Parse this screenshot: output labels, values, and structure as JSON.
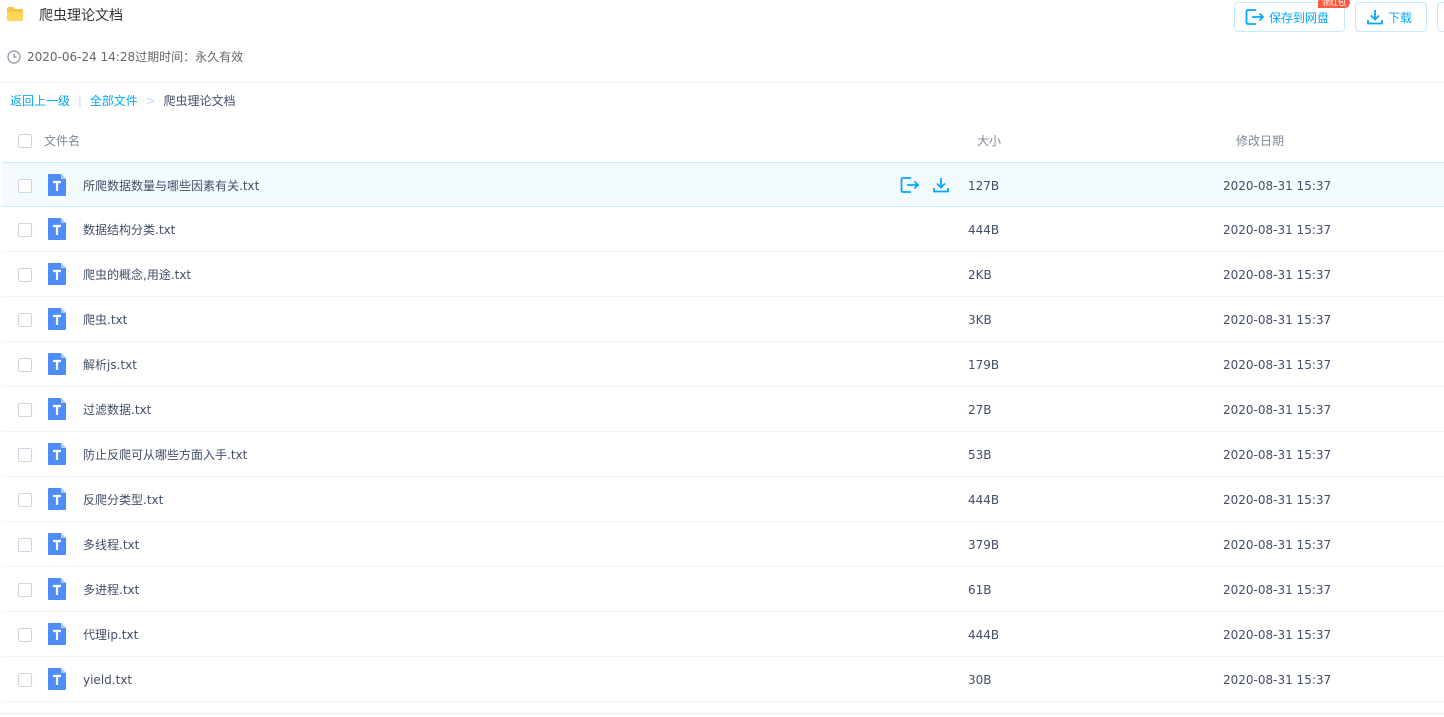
{
  "share": {
    "title": "爬虫理论文档",
    "created": "2020-06-24 14:28",
    "expire_label": "过期时间：",
    "expire_value": "永久有效"
  },
  "toolbar": {
    "save_label": "保存到网盘",
    "download_label": "下载",
    "promo_badge": "领红包"
  },
  "breadcrumb": {
    "back": "返回上一级",
    "sep": "|",
    "all_files": "全部文件",
    "arrow": ">",
    "current": "爬虫理论文档"
  },
  "columns": {
    "name": "文件名",
    "size": "大小",
    "date": "修改日期"
  },
  "colors": {
    "accent": "#06a7ff",
    "file_icon": "#4e8cf7",
    "hover_row": "#f4fbff"
  },
  "files": [
    {
      "name": "所爬数据数量与哪些因素有关.txt",
      "size": "127B",
      "date": "2020-08-31 15:37",
      "icon": "txt-file-icon"
    },
    {
      "name": "数据结构分类.txt",
      "size": "444B",
      "date": "2020-08-31 15:37",
      "icon": "txt-file-icon"
    },
    {
      "name": "爬虫的概念,用途.txt",
      "size": "2KB",
      "date": "2020-08-31 15:37",
      "icon": "txt-file-icon"
    },
    {
      "name": "爬虫.txt",
      "size": "3KB",
      "date": "2020-08-31 15:37",
      "icon": "txt-file-icon"
    },
    {
      "name": "解析js.txt",
      "size": "179B",
      "date": "2020-08-31 15:37",
      "icon": "txt-file-icon"
    },
    {
      "name": "过滤数据.txt",
      "size": "27B",
      "date": "2020-08-31 15:37",
      "icon": "txt-file-icon"
    },
    {
      "name": "防止反爬可从哪些方面入手.txt",
      "size": "53B",
      "date": "2020-08-31 15:37",
      "icon": "txt-file-icon"
    },
    {
      "name": "反爬分类型.txt",
      "size": "444B",
      "date": "2020-08-31 15:37",
      "icon": "txt-file-icon"
    },
    {
      "name": "多线程.txt",
      "size": "379B",
      "date": "2020-08-31 15:37",
      "icon": "txt-file-icon"
    },
    {
      "name": "多进程.txt",
      "size": "61B",
      "date": "2020-08-31 15:37",
      "icon": "txt-file-icon"
    },
    {
      "name": "代理ip.txt",
      "size": "444B",
      "date": "2020-08-31 15:37",
      "icon": "txt-file-icon"
    },
    {
      "name": "yield.txt",
      "size": "30B",
      "date": "2020-08-31 15:37",
      "icon": "txt-file-icon"
    }
  ]
}
